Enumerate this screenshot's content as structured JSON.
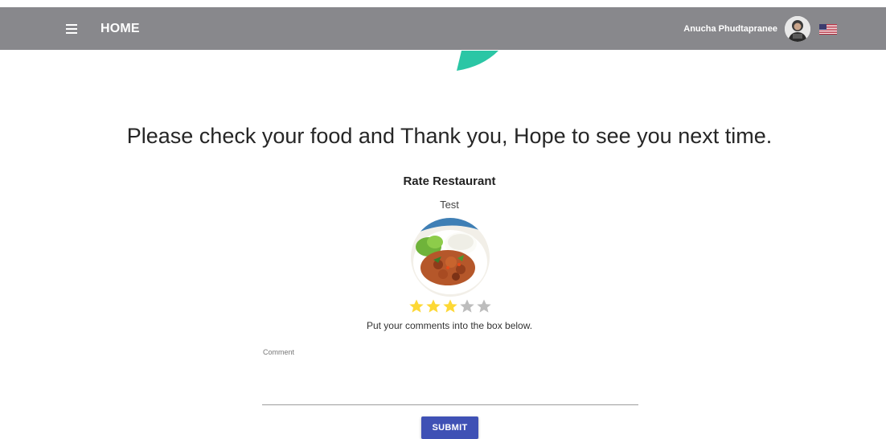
{
  "header": {
    "title": "HOME",
    "user_name": "Anucha Phudtapranee",
    "menu_icon": "hamburger-menu-icon",
    "flag_icon": "us-flag-icon",
    "background_color": "#88888c"
  },
  "main": {
    "thanks_message": "Please check your food and Thank you, Hope to see you next time.",
    "rate_title": "Rate Restaurant",
    "restaurant_name": "Test",
    "rating": {
      "value": 3,
      "max": 5
    },
    "star_colors": {
      "filled": "#fdd835",
      "empty": "#bdbdbd"
    },
    "instructions": "Put your comments into the box below.",
    "comment": {
      "label": "Comment",
      "value": ""
    },
    "submit_label": "SUBMIT",
    "accent_color": "#3f51b5",
    "decor_color": "#2bc6a5"
  }
}
